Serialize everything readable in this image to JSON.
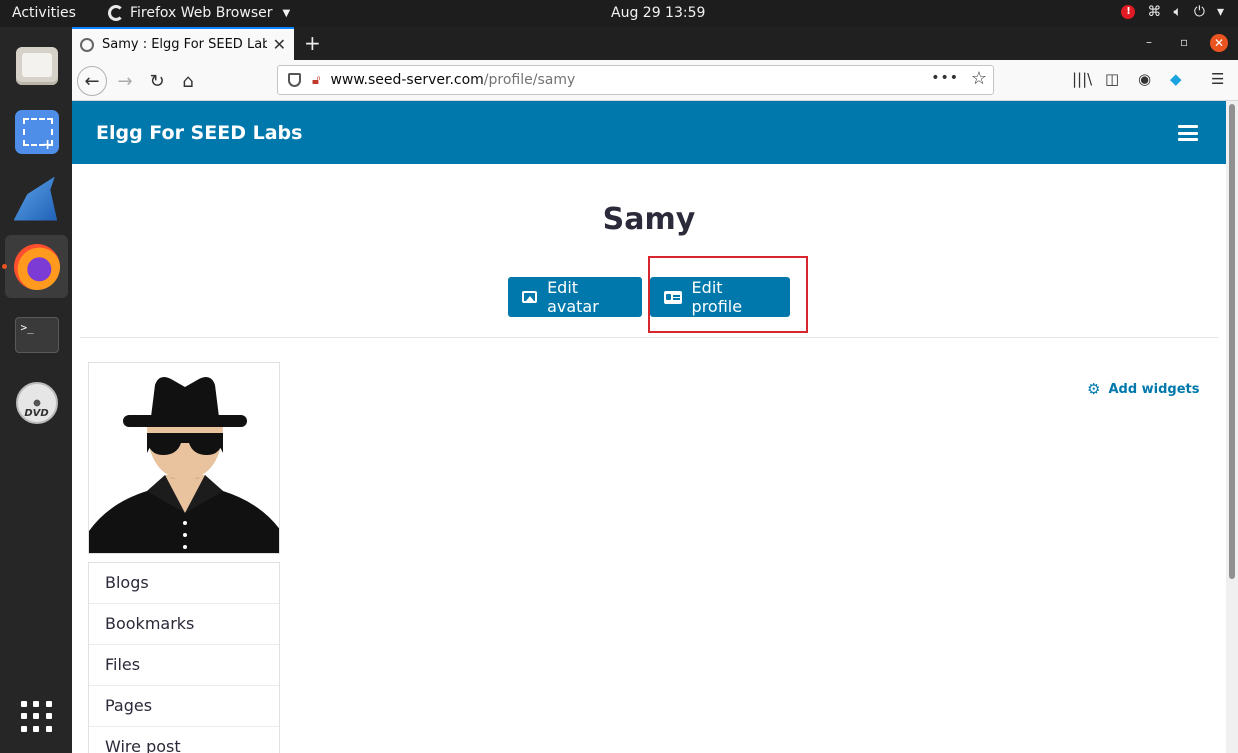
{
  "topbar": {
    "activities": "Activities",
    "app_name": "Firefox Web Browser",
    "clock": "Aug 29  13:59",
    "alert": "!"
  },
  "dock": {
    "items": [
      "files-icon",
      "screenshot-icon",
      "wireshark-icon",
      "firefox-icon",
      "terminal-icon",
      "dvd-icon",
      "app-grid-icon"
    ]
  },
  "browser": {
    "tab_title": "Samy : Elgg For SEED Labs",
    "url_host": "www.seed-server.com",
    "url_path": "/profile/samy"
  },
  "site": {
    "name": "Elgg For SEED Labs"
  },
  "profile": {
    "name": "Samy",
    "edit_avatar_label": "Edit avatar",
    "edit_profile_label": "Edit profile",
    "add_widgets_label": "Add widgets",
    "menu": [
      "Blogs",
      "Bookmarks",
      "Files",
      "Pages",
      "Wire post"
    ]
  },
  "colors": {
    "brand": "#0078ac",
    "highlight": "#d8262f"
  }
}
